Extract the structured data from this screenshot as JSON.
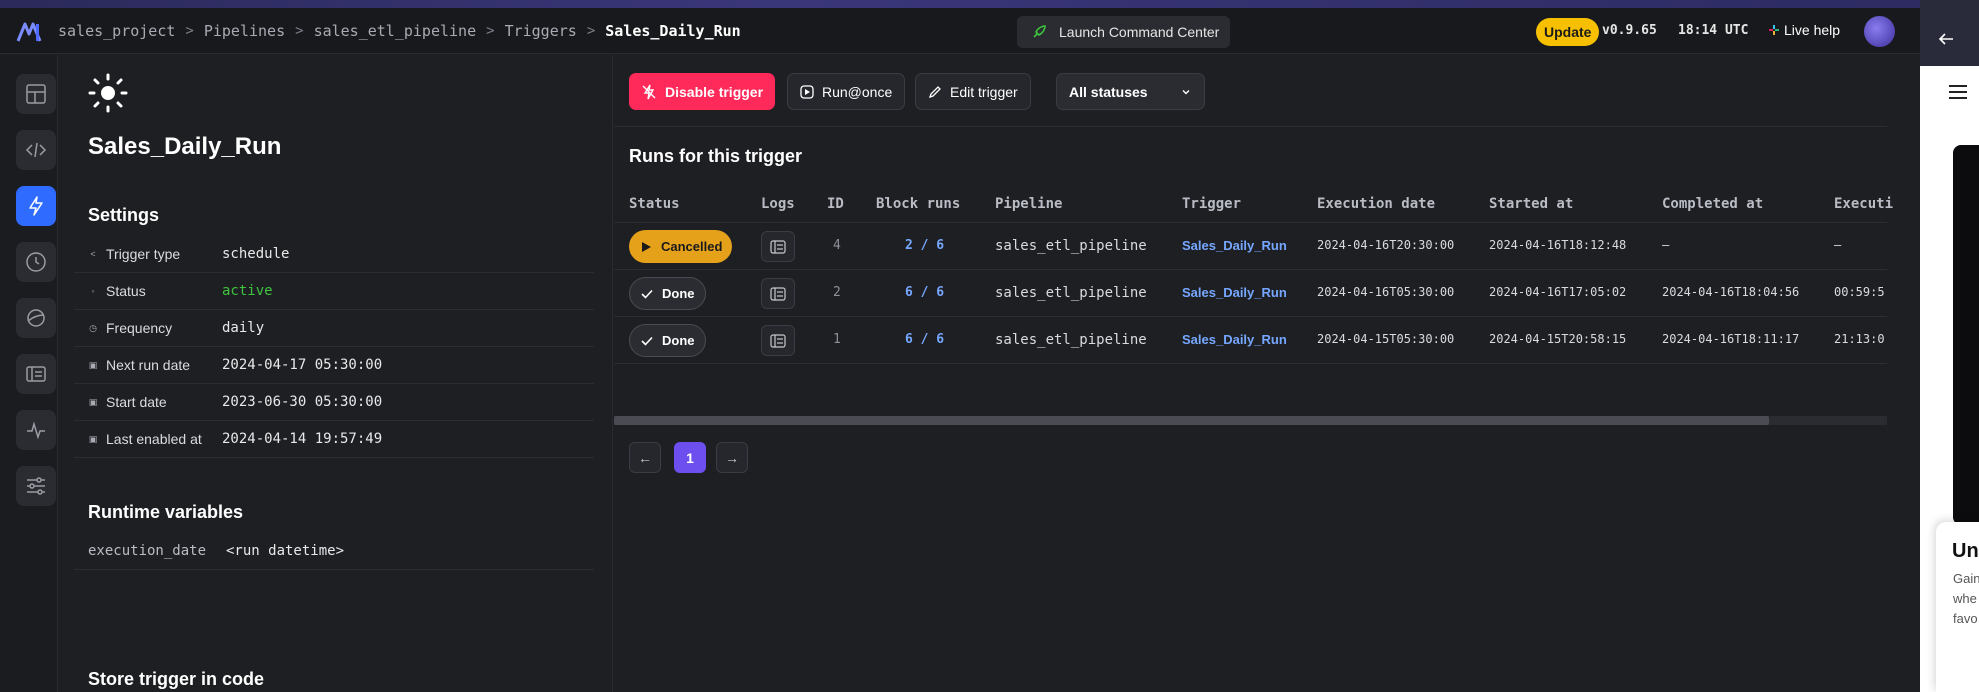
{
  "breadcrumbs": [
    "sales_project",
    "Pipelines",
    "sales_etl_pipeline",
    "Triggers",
    "Sales_Daily_Run"
  ],
  "breadcrumb_separator": ">",
  "header": {
    "command_center": "Launch Command Center",
    "update": "Update",
    "version": "v0.9.65",
    "time": "18:14 UTC",
    "live_help": "Live help"
  },
  "trigger": {
    "title": "Sales_Daily_Run",
    "settings_heading": "Settings",
    "settings": [
      {
        "label": "Trigger type",
        "value": "schedule",
        "icon": "trigger-type-icon"
      },
      {
        "label": "Status",
        "value": "active",
        "icon": "status-icon"
      },
      {
        "label": "Frequency",
        "value": "daily",
        "icon": "clock-icon"
      },
      {
        "label": "Next run date",
        "value": "2024-04-17 05:30:00",
        "icon": "calendar-icon"
      },
      {
        "label": "Start date",
        "value": "2023-06-30 05:30:00",
        "icon": "calendar-icon"
      },
      {
        "label": "Last enabled at",
        "value": "2024-04-14 19:57:49",
        "icon": "calendar-icon"
      }
    ],
    "runtime_heading": "Runtime variables",
    "runtime_vars": [
      {
        "key": "execution_date",
        "value": "<run datetime>"
      }
    ],
    "store_heading": "Store trigger in code"
  },
  "toolbar": {
    "disable": "Disable trigger",
    "run_once": "Run@once",
    "edit": "Edit trigger",
    "status_filter": "All statuses"
  },
  "runs": {
    "title": "Runs for this trigger",
    "columns": [
      "Status",
      "Logs",
      "ID",
      "Block runs",
      "Pipeline",
      "Trigger",
      "Execution date",
      "Started at",
      "Completed at",
      "Executi"
    ],
    "rows": [
      {
        "status": "Cancelled",
        "id": "4",
        "block_runs": "2 / 6",
        "pipeline": "sales_etl_pipeline",
        "trigger": "Sales_Daily_Run",
        "execution_date": "2024-04-16T20:30:00",
        "started_at": "2024-04-16T18:12:48",
        "completed_at": "–",
        "execution_time": "–"
      },
      {
        "status": "Done",
        "id": "2",
        "block_runs": "6 / 6",
        "pipeline": "sales_etl_pipeline",
        "trigger": "Sales_Daily_Run",
        "execution_date": "2024-04-16T05:30:00",
        "started_at": "2024-04-16T17:05:02",
        "completed_at": "2024-04-16T18:04:56",
        "execution_time": "00:59:5"
      },
      {
        "status": "Done",
        "id": "1",
        "block_runs": "6 / 6",
        "pipeline": "sales_etl_pipeline",
        "trigger": "Sales_Daily_Run",
        "execution_date": "2024-04-15T05:30:00",
        "started_at": "2024-04-15T20:58:15",
        "completed_at": "2024-04-16T18:11:17",
        "execution_time": "21:13:0"
      }
    ]
  },
  "pagination": {
    "prev": "←",
    "current": "1",
    "next": "→"
  },
  "side_panel": {
    "title": "Unl",
    "lines": [
      "Gain",
      "whe",
      "favo"
    ]
  },
  "colors": {
    "accent_red": "#ff2a5a",
    "active_green": "#3ec33e",
    "link_blue": "#76a7ff",
    "page_purple": "#6d4ff0",
    "update_yellow": "#f6c000"
  }
}
